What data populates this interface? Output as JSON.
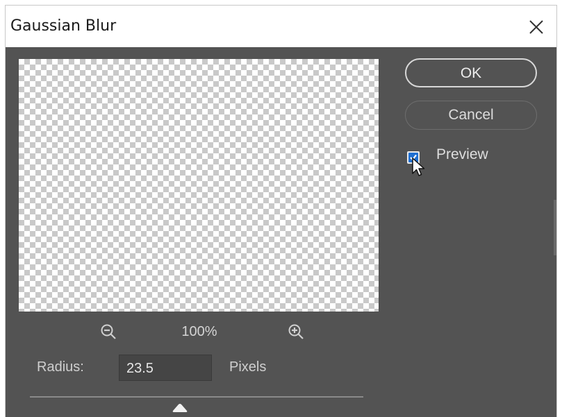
{
  "dialog": {
    "title": "Gaussian Blur",
    "close_icon": "close-icon"
  },
  "preview_area": {
    "zoom_out_icon": "zoom-out-icon",
    "zoom_level": "100%",
    "zoom_in_icon": "zoom-in-icon"
  },
  "radius": {
    "label": "Radius:",
    "value": "23.5",
    "units": "Pixels",
    "slider_position_percent": 45
  },
  "buttons": {
    "ok_label": "OK",
    "cancel_label": "Cancel"
  },
  "preview_option": {
    "label": "Preview",
    "checked": true
  },
  "colors": {
    "dialog_bg": "#535353",
    "checkbox_accent": "#1f6fd1"
  }
}
